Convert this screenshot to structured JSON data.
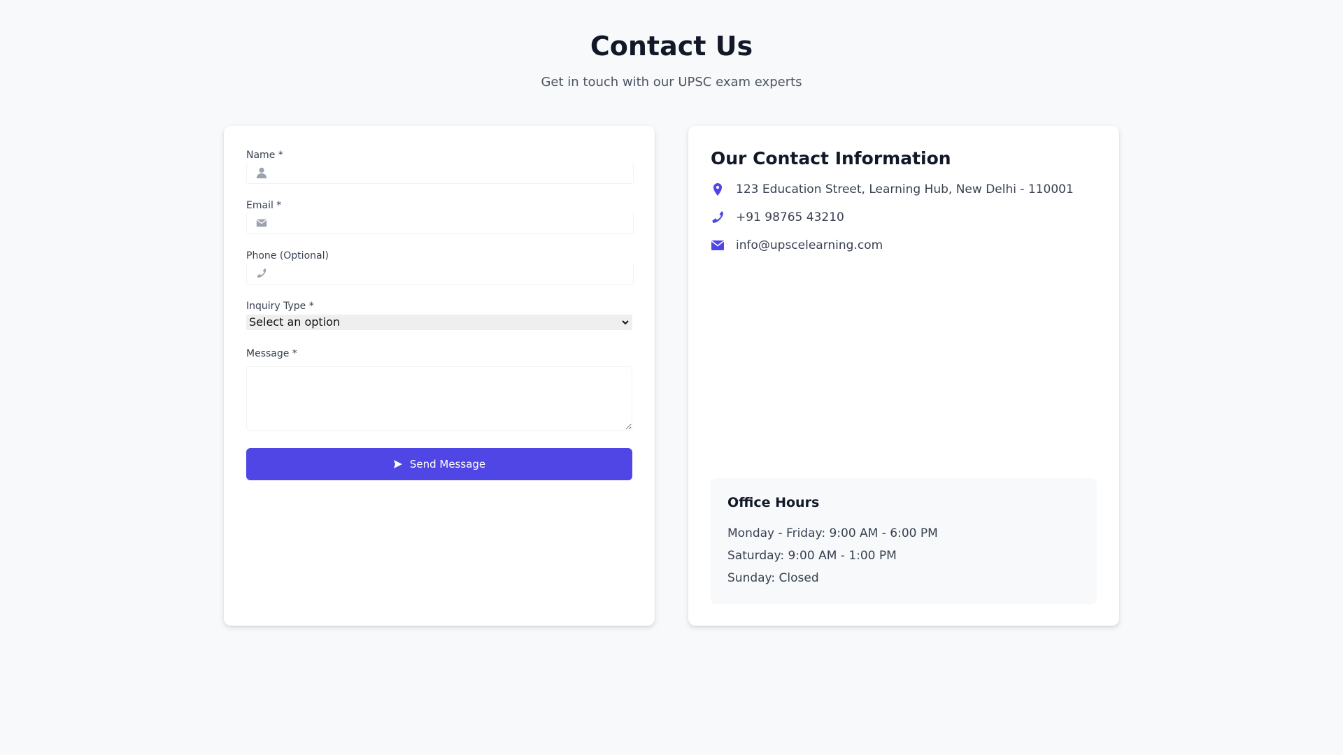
{
  "header": {
    "title": "Contact Us",
    "subtitle": "Get in touch with our UPSC exam experts"
  },
  "form": {
    "name_label": "Name *",
    "name_value": "",
    "email_label": "Email *",
    "email_value": "",
    "phone_label": "Phone (Optional)",
    "phone_value": "",
    "inquiry_label": "Inquiry Type *",
    "inquiry_selected": "Select an option",
    "message_label": "Message *",
    "message_value": "",
    "send_label": "Send Message",
    "icons": {
      "name": "user-icon",
      "email": "envelope-icon",
      "phone": "phone-icon",
      "send": "paper-plane-icon"
    }
  },
  "contact_info": {
    "title": "Our Contact Information",
    "items": [
      {
        "icon": "location-pin-icon",
        "text": "123 Education Street, Learning Hub, New Delhi - 110001"
      },
      {
        "icon": "phone-icon",
        "text": "+91 98765 43210"
      },
      {
        "icon": "envelope-icon",
        "text": "info@upscelearning.com"
      }
    ]
  },
  "office_hours": {
    "title": "Office Hours",
    "lines": [
      "Monday - Friday: 9:00 AM - 6:00 PM",
      "Saturday: 9:00 AM - 1:00 PM",
      "Sunday: Closed"
    ]
  },
  "colors": {
    "accent": "#4f46e5",
    "background": "#f8f9fb",
    "card": "#ffffff",
    "muted_icon": "#9ca3af",
    "text_dark": "#111827",
    "text_body": "#374151"
  }
}
